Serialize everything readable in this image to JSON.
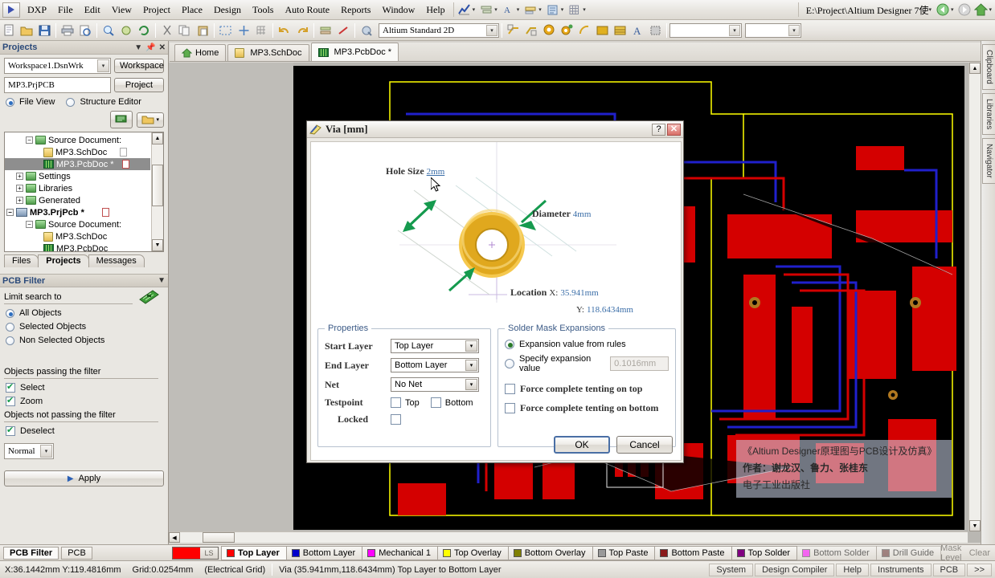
{
  "menubar": {
    "logo": "dxp-logo-icon",
    "items": [
      "DXP",
      "File",
      "Edit",
      "View",
      "Project",
      "Place",
      "Design",
      "Tools",
      "Auto Route",
      "Reports",
      "Window",
      "Help"
    ],
    "right_tools": [
      "chart-icon",
      "list-icon",
      "annotate-icon",
      "rule-icon",
      "board-icon",
      "grid-icon"
    ],
    "path": "E:\\Project\\Altium Designer 7使",
    "nav_icons": [
      "back-icon",
      "forward-icon",
      "home-icon"
    ]
  },
  "toolbar": {
    "view_preset": "Altium Standard 2D",
    "icons": [
      "new-icon",
      "open-icon",
      "save-icon",
      "print-icon",
      "preview-icon",
      "zoom-area-icon",
      "pan-icon",
      "refresh-icon",
      "cut-icon",
      "copy-icon",
      "paste-icon",
      "select-area-icon",
      "move-icon",
      "undo-icon",
      "redo-icon",
      "xsection-icon",
      "measure-icon",
      "highlight-icon"
    ],
    "place_icons": [
      "place-track-icon",
      "place-line-icon",
      "place-pad-icon",
      "place-via-icon",
      "place-arc-icon",
      "place-fill-icon",
      "place-polygon-icon",
      "place-string-icon",
      "place-component-icon"
    ]
  },
  "doc_tabs": [
    {
      "label": "Home",
      "icon": "home-icon",
      "active": false
    },
    {
      "label": "MP3.SchDoc",
      "icon": "sch-icon",
      "active": false
    },
    {
      "label": "MP3.PcbDoc *",
      "icon": "pcb-icon",
      "active": true
    }
  ],
  "projects_panel": {
    "title": "Projects",
    "title_icons": [
      "chevron-down-icon",
      "pin-icon",
      "close-icon"
    ],
    "workspace_value": "Workspace1.DsnWrk",
    "workspace_button": "Workspace",
    "project_value": "MP3.PrjPCB",
    "project_button": "Project",
    "view_modes": [
      {
        "label": "File View",
        "selected": true
      },
      {
        "label": "Structure Editor",
        "selected": false
      }
    ],
    "tool_icons": [
      "compile-icon",
      "open-project-icon"
    ],
    "tree": [
      {
        "label": "Source Document:",
        "indent": 1,
        "type": "folder",
        "expander": "-",
        "badge": ""
      },
      {
        "label": "MP3.SchDoc",
        "indent": 2,
        "type": "sch",
        "expander": "",
        "badge": "grey"
      },
      {
        "label": "MP3.PcbDoc *",
        "indent": 2,
        "type": "pcb",
        "expander": "",
        "badge": "red",
        "selected": true
      },
      {
        "label": "Settings",
        "indent": 1,
        "type": "folder",
        "expander": "+",
        "badge": ""
      },
      {
        "label": "Libraries",
        "indent": 1,
        "type": "folder",
        "expander": "+",
        "badge": ""
      },
      {
        "label": "Generated",
        "indent": 1,
        "type": "folder",
        "expander": "+",
        "badge": ""
      },
      {
        "label": "MP3.PrjPcb *",
        "indent": 0,
        "type": "project",
        "expander": "-",
        "badge": "red",
        "bold": true
      },
      {
        "label": "Source Document:",
        "indent": 1,
        "type": "folder",
        "expander": "-",
        "badge": ""
      },
      {
        "label": "MP3.SchDoc",
        "indent": 2,
        "type": "sch",
        "expander": "",
        "badge": ""
      },
      {
        "label": "MP3.PcbDoc",
        "indent": 2,
        "type": "pcb",
        "expander": "",
        "badge": ""
      }
    ],
    "bottom_tabs": [
      {
        "label": "Files",
        "active": false
      },
      {
        "label": "Projects",
        "active": true
      },
      {
        "label": "Messages",
        "active": false
      }
    ]
  },
  "pcb_filter_panel": {
    "title": "PCB Filter",
    "limit_search_label": "Limit search to",
    "scope_options": [
      {
        "label": "All Objects",
        "selected": true
      },
      {
        "label": "Selected Objects",
        "selected": false
      },
      {
        "label": "Non Selected Objects",
        "selected": false
      }
    ],
    "passing_label": "Objects passing the filter",
    "passing_options": [
      {
        "label": "Select",
        "checked": true
      },
      {
        "label": "Zoom",
        "checked": true
      }
    ],
    "not_passing_label": "Objects not passing the filter",
    "not_passing_options": [
      {
        "label": "Deselect",
        "checked": true
      }
    ],
    "mode_value": "Normal",
    "apply_label": "Apply"
  },
  "pcb_filter_bar": {
    "tabs": [
      {
        "label": "PCB Filter",
        "active": true
      },
      {
        "label": "PCB",
        "active": false
      }
    ]
  },
  "right_rail": {
    "tabs": [
      "Clipboard",
      "Libraries",
      "Navigator"
    ]
  },
  "layer_tabs": {
    "ls_label": "LS",
    "ls_color": "#ff0000",
    "tabs": [
      {
        "label": "Top Layer",
        "color": "#ff0000",
        "active": true
      },
      {
        "label": "Bottom Layer",
        "color": "#0000cc",
        "active": false
      },
      {
        "label": "Mechanical 1",
        "color": "#ff00ff",
        "active": false
      },
      {
        "label": "Top Overlay",
        "color": "#ffff00",
        "active": false
      },
      {
        "label": "Bottom Overlay",
        "color": "#808000",
        "active": false
      },
      {
        "label": "Top Paste",
        "color": "#999999",
        "active": false
      },
      {
        "label": "Bottom Paste",
        "color": "#8b1a1a",
        "active": false
      },
      {
        "label": "Top Solder",
        "color": "#800080",
        "active": false
      },
      {
        "label": "Bottom Solder",
        "color": "#ff00ff",
        "active": false
      },
      {
        "label": "Drill Guide",
        "color": "#663333",
        "active": false
      }
    ],
    "mask_level_label": "Mask Level",
    "clear_label": "Clear"
  },
  "dialog": {
    "title": "Via [mm]",
    "title_buttons": [
      "help-icon",
      "close-icon"
    ],
    "preview": {
      "hole_size_label": "Hole Size",
      "hole_size_value": "2mm",
      "diameter_label": "Diameter",
      "diameter_value": "4mm",
      "location_label": "Location",
      "x_label": "X:",
      "x_value": "35.941mm",
      "y_label": "Y:",
      "y_value": "118.6434mm"
    },
    "properties": {
      "group_label": "Properties",
      "start_layer_label": "Start Layer",
      "start_layer_value": "Top Layer",
      "end_layer_label": "End Layer",
      "end_layer_value": "Bottom Layer",
      "net_label": "Net",
      "net_value": "No Net",
      "testpoint_label": "Testpoint",
      "testpoint_top_label": "Top",
      "testpoint_top_checked": false,
      "testpoint_bottom_label": "Bottom",
      "testpoint_bottom_checked": false,
      "locked_label": "Locked",
      "locked_checked": false
    },
    "solder_mask": {
      "group_label": "Solder Mask Expansions",
      "from_rules_label": "Expansion value from rules",
      "from_rules_selected": true,
      "specify_label": "Specify expansion value",
      "specify_selected": false,
      "specify_value": "0.1016mm",
      "tent_top_label": "Force complete tenting on top",
      "tent_top_checked": false,
      "tent_bottom_label": "Force complete tenting on bottom",
      "tent_bottom_checked": false
    },
    "ok_label": "OK",
    "cancel_label": "Cancel"
  },
  "watermark": {
    "line1": "《Altium Designer原理图与PCB设计及仿真》",
    "line2": "作者：谢龙汉、鲁力、张桂东",
    "line3": "电子工业出版社"
  },
  "statusbar": {
    "coords": "X:36.1442mm Y:119.4816mm",
    "grid": "Grid:0.0254mm",
    "electrical_grid": "(Electrical Grid)",
    "object_info": "Via (35.941mm,118.6434mm) Top Layer to Bottom Layer",
    "panel_buttons": [
      "System",
      "Design Compiler",
      "Help",
      "Instruments",
      "PCB"
    ],
    "more_label": ">>"
  }
}
